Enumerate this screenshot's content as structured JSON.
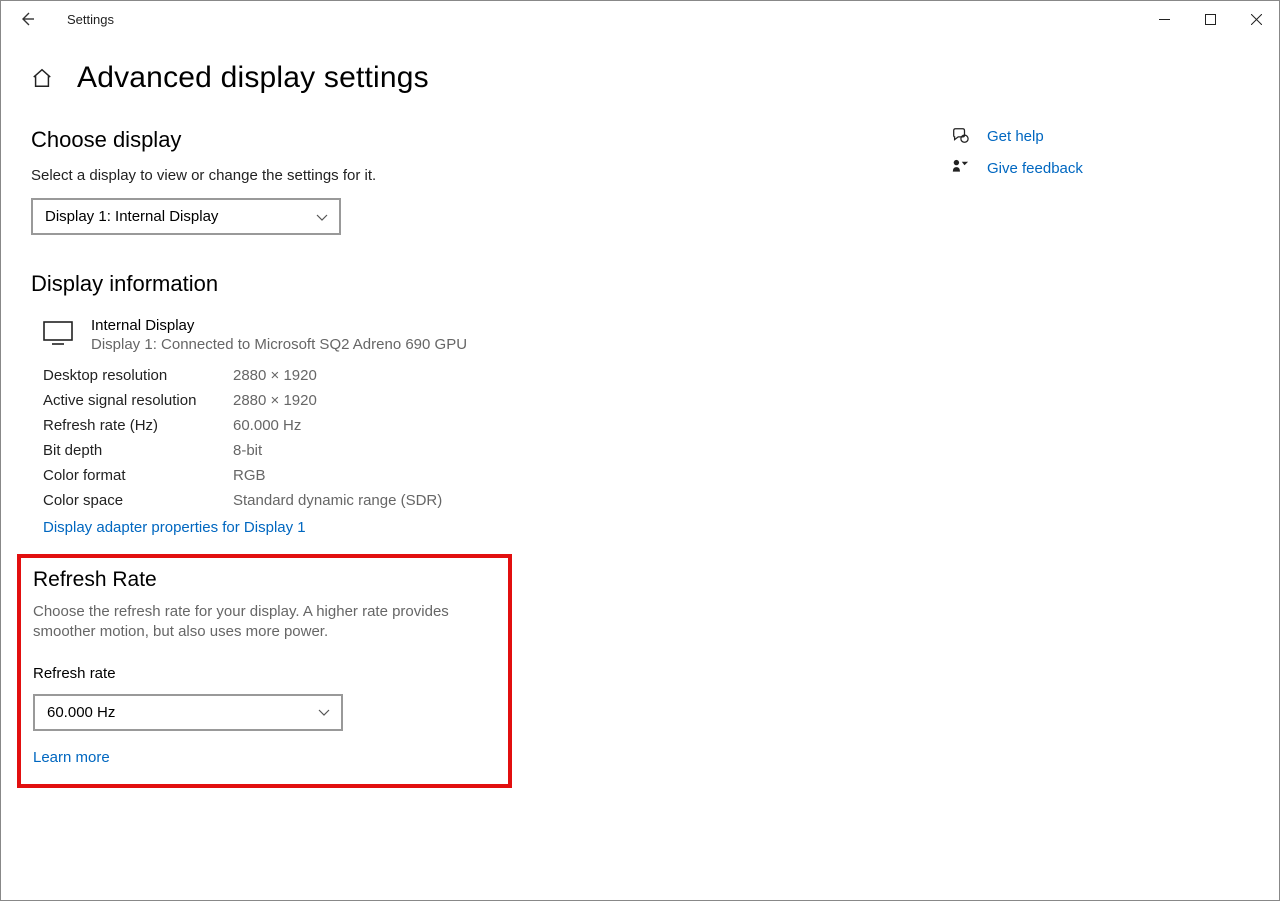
{
  "titlebar": {
    "app_name": "Settings"
  },
  "header": {
    "page_title": "Advanced display settings"
  },
  "choose": {
    "heading": "Choose display",
    "desc": "Select a display to view or change the settings for it.",
    "selected": "Display 1: Internal Display"
  },
  "info": {
    "heading": "Display information",
    "display_name": "Internal Display",
    "display_sub": "Display 1: Connected to Microsoft SQ2 Adreno 690 GPU",
    "rows": [
      {
        "label": "Desktop resolution",
        "value": "2880 × 1920"
      },
      {
        "label": "Active signal resolution",
        "value": "2880 × 1920"
      },
      {
        "label": "Refresh rate (Hz)",
        "value": "60.000 Hz"
      },
      {
        "label": "Bit depth",
        "value": "8-bit"
      },
      {
        "label": "Color format",
        "value": "RGB"
      },
      {
        "label": "Color space",
        "value": "Standard dynamic range (SDR)"
      }
    ],
    "adapter_link": "Display adapter properties for Display 1"
  },
  "refresh": {
    "heading": "Refresh Rate",
    "desc": "Choose the refresh rate for your display. A higher rate provides smoother motion, but also uses more power.",
    "label": "Refresh rate",
    "selected": "60.000 Hz",
    "learn_more": "Learn more"
  },
  "side": {
    "get_help": "Get help",
    "give_feedback": "Give feedback"
  }
}
